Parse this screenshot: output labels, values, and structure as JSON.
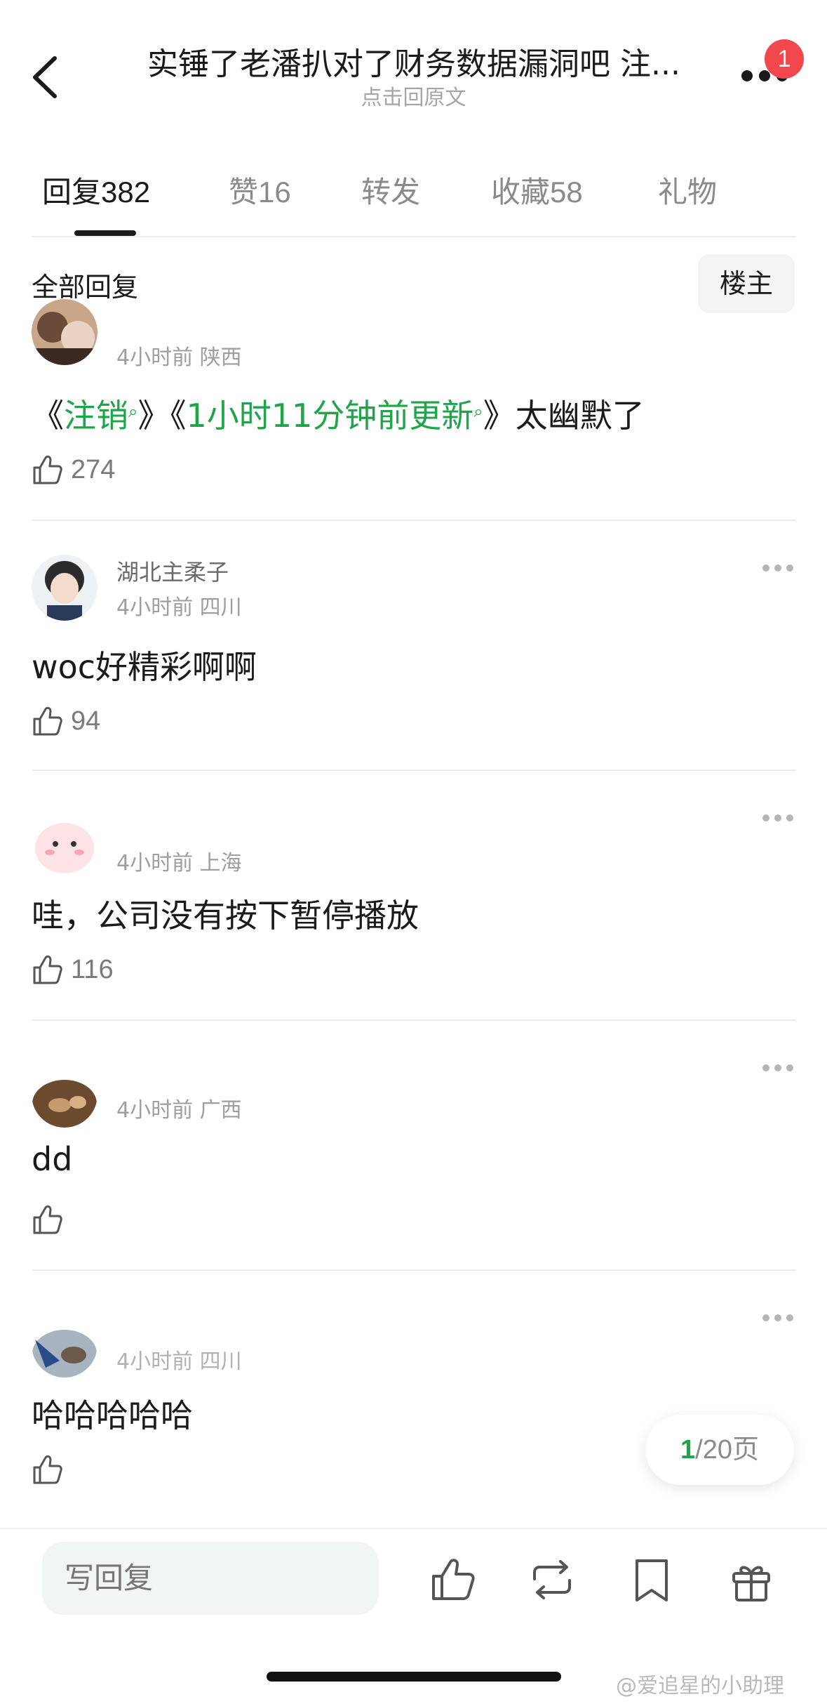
{
  "header": {
    "title": "实锤了老潘扒对了财务数据漏洞吧 注...",
    "subtitle": "点击回原文",
    "badge_count": "1"
  },
  "tabs": [
    {
      "label": "回复",
      "count": "382"
    },
    {
      "label": "赞",
      "count": "16"
    },
    {
      "label": "转发",
      "count": ""
    },
    {
      "label": "收藏",
      "count": "58"
    },
    {
      "label": "礼物",
      "count": ""
    }
  ],
  "filter": {
    "label": "全部回复",
    "owner_button": "楼主"
  },
  "comments": [
    {
      "username": "",
      "meta": "4小时前 陕西",
      "content_parts": [
        "《",
        "注销",
        "》《",
        "1小时11分钟前更新",
        "》太幽默了"
      ],
      "likes": "274"
    },
    {
      "username": "湖北主柔子",
      "meta": "4小时前 四川",
      "content": "woc好精彩啊啊",
      "likes": "94"
    },
    {
      "username": "",
      "meta": "4小时前 上海",
      "content": "哇，公司没有按下暂停播放",
      "likes": "116"
    },
    {
      "username": "",
      "meta": "4小时前 广西",
      "content": "dd",
      "likes": ""
    },
    {
      "username": "",
      "meta": "4小时前 四川",
      "content": "哈哈哈哈哈",
      "likes": ""
    }
  ],
  "pager": {
    "current": "1",
    "total": "/20页"
  },
  "bottom_bar": {
    "reply_placeholder": "写回复",
    "icons": [
      "thumbs-up-icon",
      "repost-icon",
      "bookmark-icon",
      "gift-icon"
    ]
  },
  "watermark": "@爱追星的小助理",
  "colors": {
    "accent_green": "#1ea54a",
    "badge_red": "#f0484c"
  }
}
